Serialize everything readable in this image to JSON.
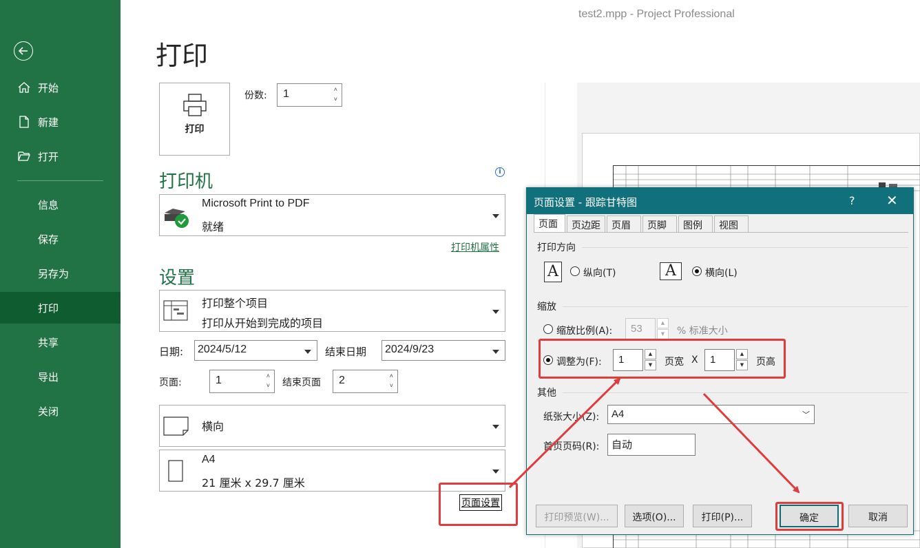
{
  "window": {
    "title": "test2.mpp  -  Project Professional"
  },
  "sidebar": {
    "items": [
      {
        "label": "开始"
      },
      {
        "label": "新建"
      },
      {
        "label": "打开"
      },
      {
        "label": "信息"
      },
      {
        "label": "保存"
      },
      {
        "label": "另存为"
      },
      {
        "label": "打印"
      },
      {
        "label": "共享"
      },
      {
        "label": "导出"
      },
      {
        "label": "关闭"
      }
    ],
    "active": "打印"
  },
  "print_pane": {
    "title": "打印",
    "print_button_label": "打印",
    "copies_label": "份数:",
    "copies_value": "1",
    "printer_heading": "打印机",
    "printer_name": "Microsoft Print to PDF",
    "printer_status": "就绪",
    "printer_properties_link": "打印机属性",
    "settings_heading": "设置",
    "scope_title": "打印整个项目",
    "scope_desc": "打印从开始到完成的项目",
    "date_label": "日期:",
    "date_value": "2024/5/12",
    "end_date_label": "结束日期",
    "end_date_value": "2024/9/23",
    "page_label": "页面:",
    "page_value": "1",
    "end_page_label": "结束页面",
    "end_page_value": "2",
    "orientation_value": "横向",
    "paper_title": "A4",
    "paper_desc": "21 厘米 x 29.7 厘米",
    "page_setup_link": "页面设置"
  },
  "dialog": {
    "title": "页面设置 - 跟踪甘特图",
    "help": "?",
    "close": "✕",
    "tabs": [
      "页面",
      "页边距",
      "页眉",
      "页脚",
      "图例",
      "视图"
    ],
    "active_tab": "页面",
    "orientation_group": "打印方向",
    "portrait_label": "纵向(T)",
    "landscape_label": "横向(L)",
    "orientation_selected": "横向(L)",
    "scaling_group": "缩放",
    "adjust_to_label": "缩放比例(A):",
    "adjust_to_value": "53",
    "adjust_to_suffix": "% 标准大小",
    "fit_to_label": "调整为(F):",
    "fit_pages_wide": "1",
    "pages_wide_label": "页宽",
    "times": "X",
    "fit_pages_tall": "1",
    "pages_tall_label": "页高",
    "scaling_selected": "调整为(F):",
    "other_group": "其他",
    "paper_size_label": "纸张大小(Z):",
    "paper_size_value": "A4",
    "first_page_label": "首页页码(R):",
    "first_page_value": "自动",
    "buttons": {
      "print_preview": "打印预览(W)...",
      "options": "选项(O)...",
      "print": "打印(P)...",
      "ok": "确定",
      "cancel": "取消"
    }
  },
  "annotation_color": "#e03c3c",
  "accent_color": "#217346"
}
